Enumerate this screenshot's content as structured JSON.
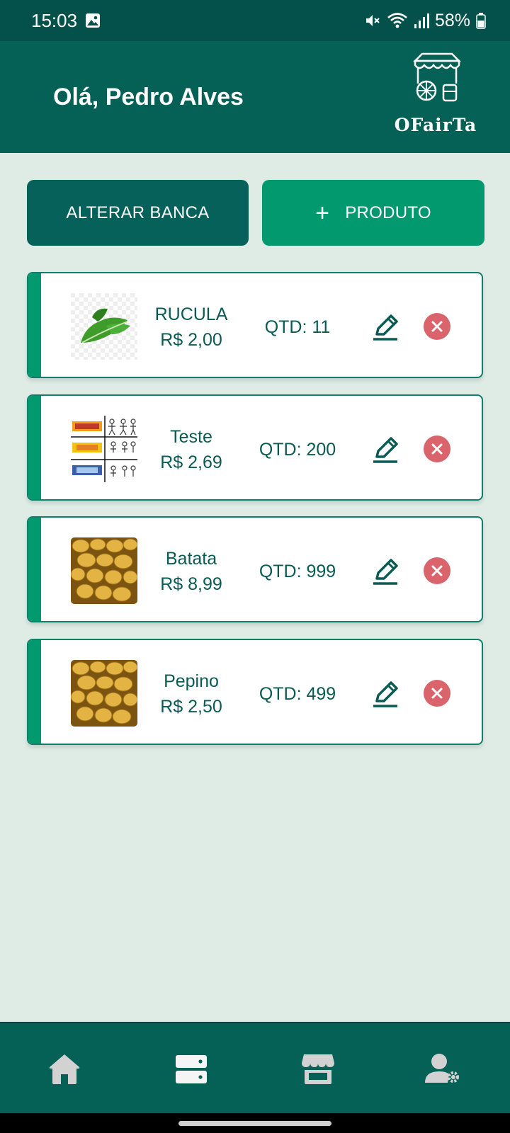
{
  "status_bar": {
    "time": "15:03",
    "battery": "58%",
    "icons": [
      "gallery-icon",
      "mute-icon",
      "wifi-icon",
      "signal-icon",
      "battery-icon"
    ]
  },
  "header": {
    "greeting": "Olá, Pedro Alves",
    "logo_text": "OFairTa"
  },
  "actions": {
    "alterar_label": "ALTERAR BANCA",
    "produto_label": "PRODUTO",
    "produto_icon": "plus-icon"
  },
  "products": [
    {
      "name": "RUCULA",
      "price": "R$ 2,00",
      "qty": "QTD: 11",
      "image": "arugula-image"
    },
    {
      "name": "Teste",
      "price": "R$ 2,69",
      "qty": "QTD: 200",
      "image": "anime-collage-image"
    },
    {
      "name": "Batata",
      "price": "R$ 8,99",
      "qty": "QTD: 999",
      "image": "potatoes-image"
    },
    {
      "name": "Pepino",
      "price": "R$ 2,50",
      "qty": "QTD: 499",
      "image": "potatoes-image"
    }
  ],
  "bottom_nav": {
    "items": [
      "home-icon",
      "server-icon",
      "store-icon",
      "user-settings-icon"
    ],
    "active": "server-icon"
  },
  "colors": {
    "primary_dark": "#056156",
    "status_bar": "#03514a",
    "accent_green": "#02996f",
    "background": "#dfece6",
    "text_green": "#0a5b53",
    "delete_red": "#d9646b",
    "icon_inactive": "#d2d2d2"
  }
}
